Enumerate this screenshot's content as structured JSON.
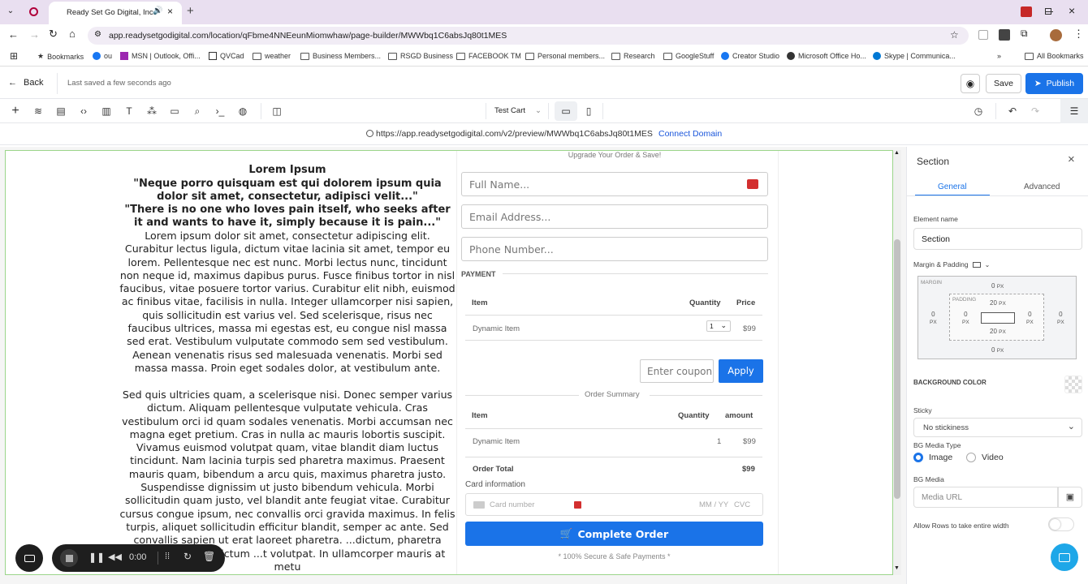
{
  "browser": {
    "tab_title": "Ready Set Go Digital, Inc.",
    "url": "app.readysetgodigital.com/location/qFbme4NNEeunMiomwhaw/page-builder/MWWbq1C6absJq80t1MES",
    "bookmarks": [
      "Bookmarks",
      "ou",
      "MSN | Outlook, Offi...",
      "QVCad",
      "weather",
      "Business Members...",
      "RSGD Business",
      "FACEBOOK TM",
      "Personal members...",
      "Research",
      "GoogleStuff",
      "Creator Studio",
      "Microsoft Office Ho...",
      "Skype | Communica..."
    ],
    "all_bookmarks": "All Bookmarks"
  },
  "header": {
    "back_label": "Back",
    "last_saved": "Last saved a few seconds ago",
    "save_label": "Save",
    "publish_label": "Publish"
  },
  "toolbar": {
    "cart_select": "Test Cart"
  },
  "preview": {
    "url": "https://app.readysetgodigital.com/v2/preview/MWWbq1C6absJq80t1MES",
    "connect_domain": "Connect Domain"
  },
  "page": {
    "title": "Lorem Ipsum",
    "quote1": "\"Neque porro quisquam est qui dolorem ipsum quia dolor sit amet, consectetur, adipisci velit...\"",
    "quote2": "\"There is no one who loves pain itself, who seeks after it and wants to have it, simply because it is pain...\"",
    "para1": "Lorem ipsum dolor sit amet, consectetur adipiscing elit. Curabitur lectus ligula, dictum vitae lacinia sit amet, tempor eu lorem. Pellentesque nec est nunc. Morbi lectus nunc, tincidunt non neque id, maximus dapibus purus. Fusce finibus tortor in nisl faucibus, vitae posuere tortor varius. Curabitur elit nibh, euismod ac finibus vitae, facilisis in nulla. Integer ullamcorper nisi sapien, quis sollicitudin est varius vel. Sed scelerisque, risus nec faucibus ultrices, massa mi egestas est, eu congue nisl massa sed erat. Vestibulum vulputate commodo sem sed vestibulum. Aenean venenatis risus sed malesuada venenatis. Morbi sed massa massa. Proin eget sodales dolor, at vestibulum ante.",
    "para2": "Sed quis ultricies quam, a scelerisque nisi. Donec semper varius dictum. Aliquam pellentesque vulputate vehicula. Cras vestibulum orci id quam sodales venenatis. Morbi accumsan nec magna eget pretium. Cras in nulla ac mauris lobortis suscipit. Vivamus euismod volutpat quam, vitae blandit diam luctus tincidunt. Nam lacinia turpis sed pharetra maximus. Praesent mauris quam, bibendum a arcu quis, maximus pharetra justo. Suspendisse dignissim ut justo bibendum vehicula. Morbi sollicitudin quam justo, vel blandit ante feugiat vitae. Curabitur cursus congue ipsum, nec convallis orci gravida maximus. In felis turpis, aliquet sollicitudin efficitur blandit, semper ac ante. Sed convallis sapien ut erat laoreet pharetra. ...dictum, pharetra lacus dignissim, dictum ...t volutpat. In ullamcorper mauris at metu"
  },
  "order": {
    "upgrade_text": "Upgrade Your Order & Save!",
    "full_name_placeholder": "Full Name...",
    "email_placeholder": "Email Address...",
    "phone_placeholder": "Phone Number...",
    "payment_label": "PAYMENT",
    "col_item": "Item",
    "col_quantity": "Quantity",
    "col_price": "Price",
    "item_name": "Dynamic Item",
    "item_qty": "1",
    "item_price": "$99",
    "coupon_placeholder": "Enter coupon",
    "apply_label": "Apply",
    "summary_label": "Order Summary",
    "col_amount": "amount",
    "summary_qty": "1",
    "summary_amount": "$99",
    "order_total_label": "Order Total",
    "order_total": "$99",
    "card_info_label": "Card information",
    "card_number_placeholder": "Card number",
    "mm_yy": "MM / YY",
    "cvc": "CVC",
    "complete_label": "Complete Order",
    "secure_text": "* 100% Secure & Safe Payments *"
  },
  "recorder": {
    "time": "0:00"
  },
  "panel": {
    "title": "Section",
    "tab_general": "General",
    "tab_advanced": "Advanced",
    "element_name_label": "Element name",
    "element_name_value": "Section",
    "margin_padding_label": "Margin & Padding",
    "margin_label": "MARGIN",
    "padding_label": "PADDING",
    "margin_top": "0",
    "margin_bottom": "0",
    "margin_left": "0",
    "margin_right": "0",
    "padding_top": "20",
    "padding_bottom": "20",
    "padding_left": "0",
    "padding_right": "0",
    "unit": "PX",
    "bg_color_label": "BACKGROUND COLOR",
    "sticky_label": "Sticky",
    "sticky_value": "No stickiness",
    "bg_media_type_label": "BG Media Type",
    "opt_image": "Image",
    "opt_video": "Video",
    "bg_media_label": "BG Media",
    "media_url_placeholder": "Media URL",
    "allow_rows_label": "Allow Rows to take entire width"
  },
  "colors": {
    "accent": "#1a73e8",
    "tab_bg": "#e9dff0",
    "selection_border": "#9bd58a"
  }
}
